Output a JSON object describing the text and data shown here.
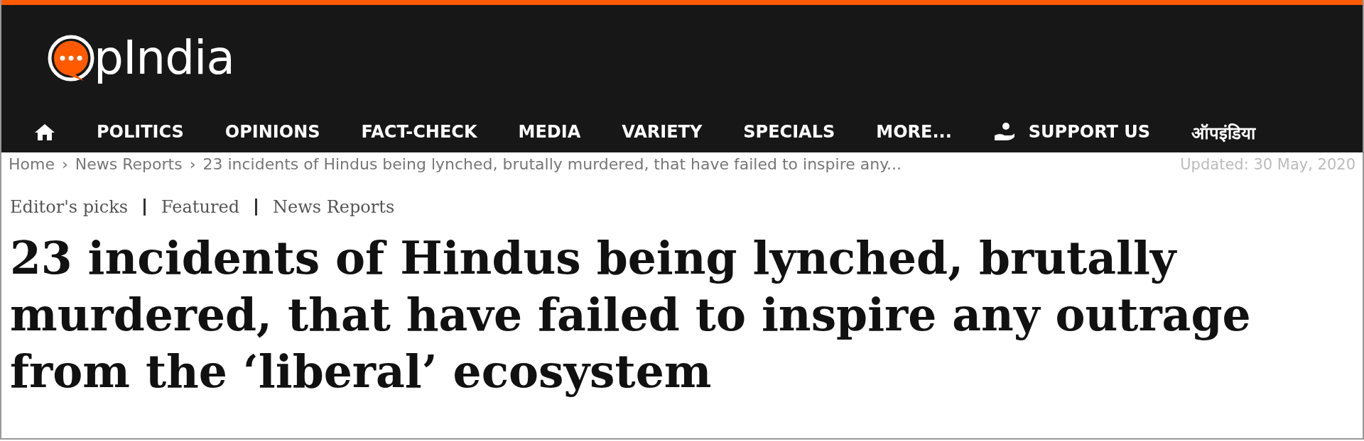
{
  "header": {
    "logo_text": "pIndia"
  },
  "nav": [
    {
      "kind": "home"
    },
    {
      "kind": "link",
      "label": "POLITICS"
    },
    {
      "kind": "link",
      "label": "OPINIONS"
    },
    {
      "kind": "link",
      "label": "FACT-CHECK"
    },
    {
      "kind": "link",
      "label": "MEDIA"
    },
    {
      "kind": "link",
      "label": "VARIETY"
    },
    {
      "kind": "link",
      "label": "SPECIALS"
    },
    {
      "kind": "link",
      "label": "MORE..."
    },
    {
      "kind": "support",
      "label": "SUPPORT US"
    },
    {
      "kind": "link",
      "label": "ऑपइंडिया"
    }
  ],
  "breadcrumb": [
    {
      "label": "Home"
    },
    {
      "separator": "›",
      "label": "News Reports"
    },
    {
      "separator": "›",
      "label": "23 incidents of Hindus being lynched, brutally murdered, that have failed to inspire any..."
    }
  ],
  "updated": "Updated: 30 May, 2020",
  "categories": [
    "Editor's picks",
    "Featured",
    "News Reports"
  ],
  "headline": "23 incidents of Hindus being lynched, brutally murdered, that have failed to inspire any outrage from the ‘liberal’ ecosystem"
}
